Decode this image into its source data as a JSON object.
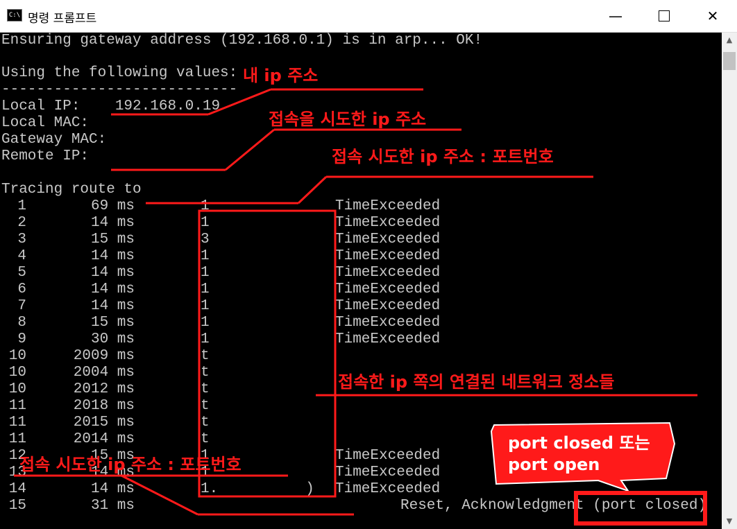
{
  "window": {
    "title": "명령 프롬프트",
    "icon_label": "C:\\",
    "min_glyph": "—",
    "close_glyph": "✕"
  },
  "console": {
    "line_gateway": "Ensuring gateway address (192.168.0.1) is in arp... OK!",
    "line_values": "Using the following values:",
    "line_dashes": "---------------------------",
    "line_local_ip": "Local IP:    192.168.0.19",
    "line_local_mac": "Local MAC:   ",
    "line_gateway_mac": "Gateway MAC: ",
    "line_remote_ip": "Remote IP:   ",
    "line_tracing": "Tracing route to ",
    "hops": [
      {
        "n": "1",
        "ms": "69 ms",
        "addr": "1",
        "result": "TimeExceeded"
      },
      {
        "n": "2",
        "ms": "14 ms",
        "addr": "1",
        "result": "TimeExceeded"
      },
      {
        "n": "3",
        "ms": "15 ms",
        "addr": "3",
        "result": "TimeExceeded"
      },
      {
        "n": "4",
        "ms": "14 ms",
        "addr": "1",
        "result": "TimeExceeded"
      },
      {
        "n": "5",
        "ms": "14 ms",
        "addr": "1",
        "result": "TimeExceeded"
      },
      {
        "n": "6",
        "ms": "14 ms",
        "addr": "1",
        "result": "TimeExceeded"
      },
      {
        "n": "7",
        "ms": "14 ms",
        "addr": "1",
        "result": "TimeExceeded"
      },
      {
        "n": "8",
        "ms": "15 ms",
        "addr": "1",
        "result": "TimeExceeded"
      },
      {
        "n": "9",
        "ms": "30 ms",
        "addr": "1",
        "result": "TimeExceeded"
      },
      {
        "n": "10",
        "ms": "2009 ms",
        "addr": "t",
        "result": ""
      },
      {
        "n": "10",
        "ms": "2004 ms",
        "addr": "t",
        "result": ""
      },
      {
        "n": "10",
        "ms": "2012 ms",
        "addr": "t",
        "result": ""
      },
      {
        "n": "11",
        "ms": "2018 ms",
        "addr": "t",
        "result": ""
      },
      {
        "n": "11",
        "ms": "2015 ms",
        "addr": "t",
        "result": ""
      },
      {
        "n": "11",
        "ms": "2014 ms",
        "addr": "t",
        "result": ""
      },
      {
        "n": "12",
        "ms": "15 ms",
        "addr": "1",
        "result": "TimeExceeded"
      },
      {
        "n": "13",
        "ms": "14 ms",
        "addr": "1",
        "result": "TimeExceeded"
      },
      {
        "n": "14",
        "ms": "14 ms",
        "addr": "1.          )",
        "result": "TimeExceeded"
      },
      {
        "n": "15",
        "ms": "31 ms",
        "addr": "",
        "result": "Reset, Acknowledgment (port closed)"
      }
    ]
  },
  "annotations": {
    "my_ip": "내 ip 주소",
    "attempted_ip": "접속을 시도한 ip 주소",
    "attempted_ip_port": "접속 시도한 ip 주소 : 포트번호",
    "network_hops": "접속한 ip 쪽의 연결된 네트워크 정소들",
    "attempted_ip_port_bottom": "접속 시도한 ip 주소 : 포트번호",
    "callout_line1": "port closed 또는",
    "callout_line2": "port open"
  },
  "colors": {
    "annotation_red": "#ff1a1a",
    "console_text": "#c8c8c8",
    "console_bg": "#000000"
  },
  "icons": {
    "app": "cmd-icon",
    "minimize": "minimize-icon",
    "maximize": "maximize-icon",
    "close": "close-icon",
    "scroll_up": "arrow-up-icon",
    "scroll_down": "arrow-down-icon"
  }
}
